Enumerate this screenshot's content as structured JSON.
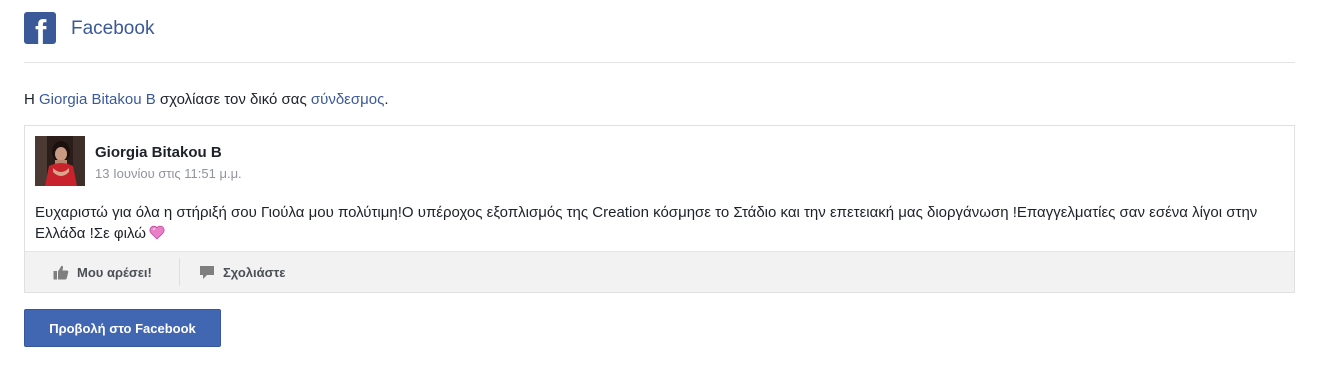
{
  "header": {
    "logo_letter": "f",
    "brand": "Facebook"
  },
  "notice": {
    "prefix": "Η ",
    "user": "Giorgia Bitakou B",
    "middle": " σχολίασε τον δικό σας ",
    "link": "σύνδεσμος",
    "suffix": "."
  },
  "post": {
    "author": "Giorgia Bitakou B",
    "timestamp": "13 Ιουνίου στις 11:51 μ.μ.",
    "text": "Ευχαριστώ για όλα η στήριξή σου Γιούλα μου πολύτιμη!Ο υπέροχος εξοπλισμός της Creation κόσμησε το Στάδιο και την επετειακή μας διοργάνωση !Επαγγελματίες σαν εσένα λίγοι στην Ελλάδα !Σε φιλώ",
    "emoji": "heart-icon"
  },
  "actions": {
    "like_label": "Μου αρέσει!",
    "comment_label": "Σχολιάστε"
  },
  "cta": {
    "label": "Προβολή στο Facebook"
  },
  "colors": {
    "brand": "#3b5998",
    "button": "#4267b2",
    "action_bar": "#f2f2f2"
  }
}
